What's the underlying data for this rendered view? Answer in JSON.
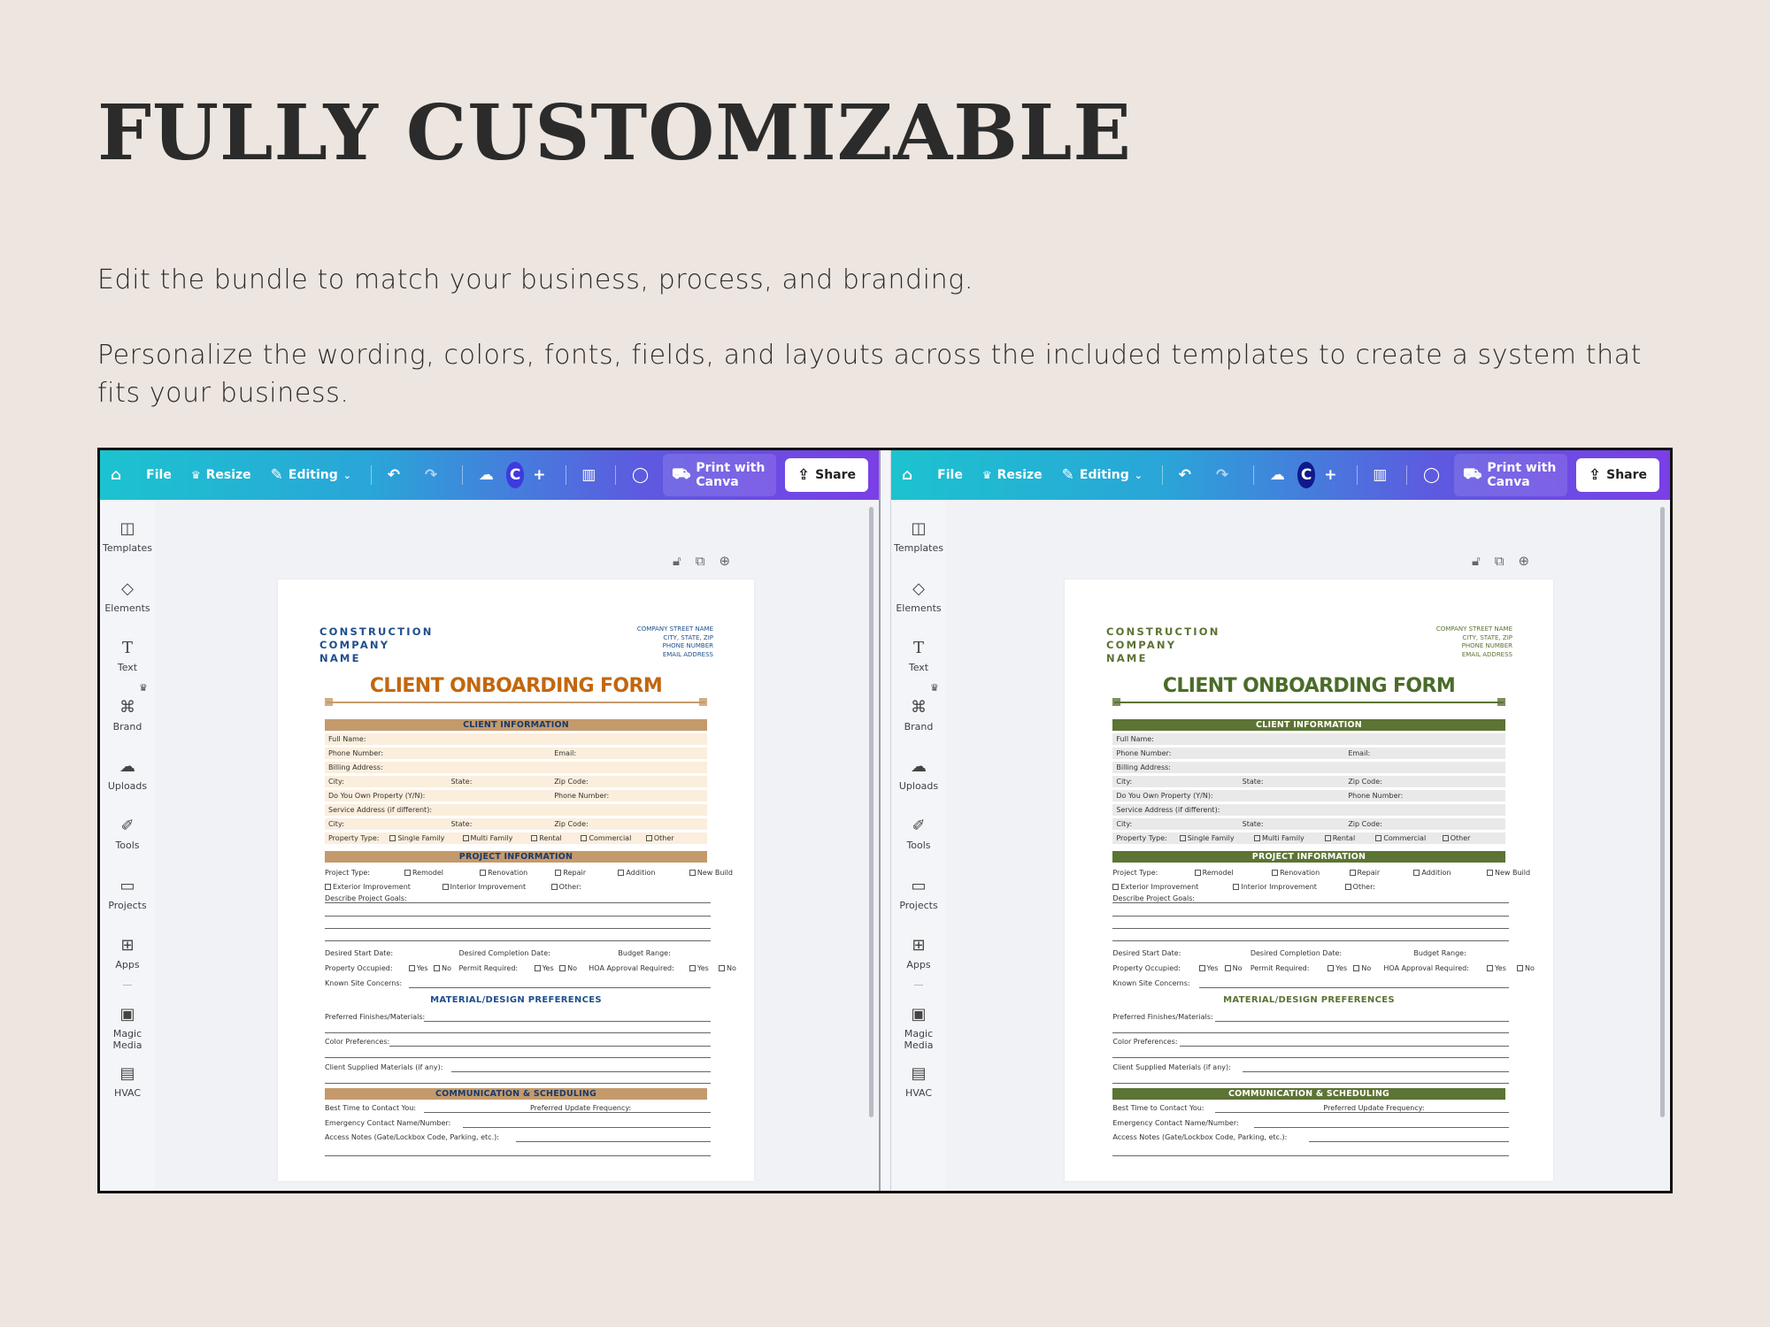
{
  "heading": "FULLY CUSTOMIZABLE",
  "paragraph1": "Edit the bundle to match your business, process, and branding.",
  "paragraph2": "Personalize the wording, colors, fonts, fields, and layouts across the included templates to create a system that fits your business.",
  "toolbar": {
    "file": "File",
    "resize": "Resize",
    "editing": "Editing",
    "avatar": "C",
    "print": "Print with Canva",
    "share": "Share"
  },
  "sidebar": [
    "Templates",
    "Elements",
    "Text",
    "Brand",
    "Uploads",
    "Tools",
    "Projects",
    "Apps",
    "Magic Media",
    "HVAC"
  ],
  "form": {
    "company": [
      "CONSTRUCTION",
      "COMPANY",
      "NAME"
    ],
    "address": [
      "COMPANY STREET NAME",
      "CITY, STATE, ZIP",
      "PHONE NUMBER",
      "EMAIL ADDRESS"
    ],
    "title": "CLIENT ONBOARDING FORM",
    "client_info": "CLIENT INFORMATION",
    "full_name": "Full Name:",
    "phone": "Phone Number:",
    "email": "Email:",
    "billing": "Billing Address:",
    "city": "City:",
    "state": "State:",
    "zip": "Zip Code:",
    "own_property": "Do You Own Property (Y/N):",
    "service_address": "Service Address (if different):",
    "property_type": "Property Type:",
    "single_family": "Single Family",
    "multi_family": "Multi Family",
    "rental": "Rental",
    "commercial": "Commercial",
    "other": "Other",
    "project_info": "PROJECT INFORMATION",
    "project_type": "Project Type:",
    "remodel": "Remodel",
    "renovation": "Renovation",
    "repair": "Repair",
    "addition": "Addition",
    "new_build": "New Build",
    "exterior": "Exterior Improvement",
    "interior": "Interior Improvement",
    "other_colon": "Other:",
    "goals": "Describe Project Goals:",
    "start": "Desired Start Date:",
    "completion": "Desired Completion Date:",
    "budget": "Budget Range:",
    "occupied": "Property Occupied:",
    "yes": "Yes",
    "no": "No",
    "permit": "Permit Required:",
    "hoa": "HOA Approval Required:",
    "site": "Known Site Concerns:",
    "material": "MATERIAL/DESIGN PREFERENCES",
    "finishes": "Preferred Finishes/Materials:",
    "color": "Color Preferences:",
    "client_supplied": "Client Supplied Materials (if any):",
    "comm": "COMMUNICATION & SCHEDULING",
    "best_time": "Best Time to Contact You:",
    "update_freq": "Preferred Update Frequency:",
    "emergency": "Emergency Contact Name/Number:",
    "access": "Access Notes (Gate/Lockbox Code, Parking, etc.):"
  },
  "themes": {
    "left": {
      "accent": "#1e4f8c",
      "title": "#c2670f",
      "bar": "#c49a6c",
      "row": "#fbeedd",
      "bar_text": "#1a3a6b"
    },
    "right": {
      "accent": "#5b7233",
      "title": "#4a6b2a",
      "bar": "#5c7434",
      "row": "#e9e9e9",
      "bar_text": "#ffffff"
    }
  }
}
